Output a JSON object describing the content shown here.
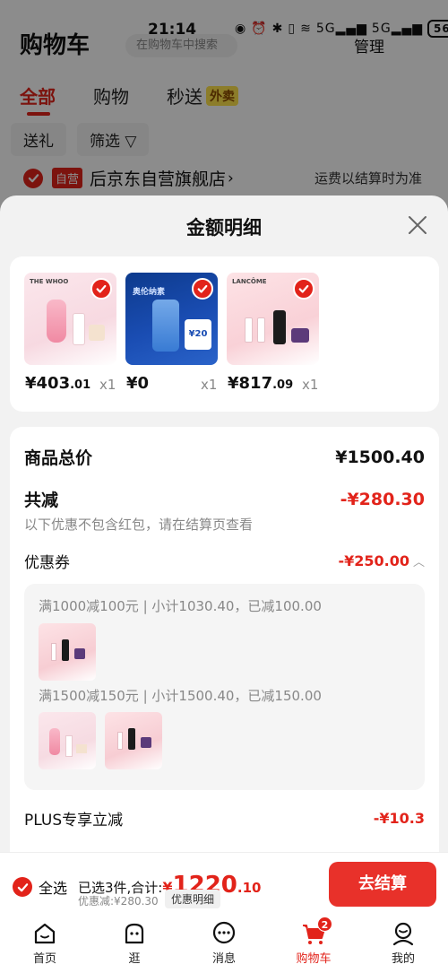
{
  "status_bar": {
    "time": "21:14",
    "network": "5G",
    "battery": "56"
  },
  "background": {
    "title": "购物车",
    "search_placeholder": "在购物车中搜索",
    "manage": "管理",
    "tabs": [
      {
        "label": "全部",
        "active": true
      },
      {
        "label": "购物",
        "active": false
      },
      {
        "label": "秒送",
        "badge": "外卖",
        "active": false
      }
    ],
    "chips": [
      {
        "label": "送礼"
      },
      {
        "label": "筛选 ▽"
      }
    ],
    "store": {
      "tag": "自营",
      "name": "后京东自营旗舰店",
      "arrow": "›",
      "shipping_note": "运费以结算时为准"
    }
  },
  "sheet": {
    "title": "金额明细",
    "products": [
      {
        "brand": "THE WHOO",
        "price_int": "¥403",
        "price_dec": ".01",
        "qty": "x1"
      },
      {
        "brand": "奥伦纳素",
        "tag": "¥20",
        "price_int": "¥0",
        "price_dec": "",
        "qty": "x1"
      },
      {
        "brand": "LANCÔME",
        "price_int": "¥817",
        "price_dec": ".09",
        "qty": "x1"
      }
    ],
    "total_label": "商品总价",
    "total_value": "¥1500.40",
    "reduction_label": "共减",
    "reduction_value": "-¥280.30",
    "reduction_note": "以下优惠不包含红包，请在结算页查看",
    "coupon_label": "优惠券",
    "coupon_value": "-¥250.00",
    "coupon_lines": [
      {
        "text": "满1000减100元 | 小计1030.40，已减100.00"
      },
      {
        "text": "满1500减150元 | 小计1500.40，已减150.00"
      }
    ],
    "plus_label": "PLUS专享立减",
    "plus_value": "-¥10.3"
  },
  "checkout": {
    "select_all": "全选",
    "selected_text": "已选3件,合计:",
    "total_symbol": "¥",
    "total_int": "1220",
    "total_dec": ".10",
    "discount": "优惠减:¥280.30",
    "detail_button": "优惠明细",
    "checkout_button": "去结算"
  },
  "nav": {
    "items": [
      {
        "label": "首页",
        "icon": "home-icon"
      },
      {
        "label": "逛",
        "icon": "explore-icon"
      },
      {
        "label": "消息",
        "icon": "message-icon"
      },
      {
        "label": "购物车",
        "icon": "cart-icon",
        "badge": "2",
        "active": true
      },
      {
        "label": "我的",
        "icon": "profile-icon"
      }
    ]
  },
  "colors": {
    "accent": "#e2231a",
    "checkout_button": "#e8312a",
    "sheet_bg": "#f2f2f2"
  }
}
